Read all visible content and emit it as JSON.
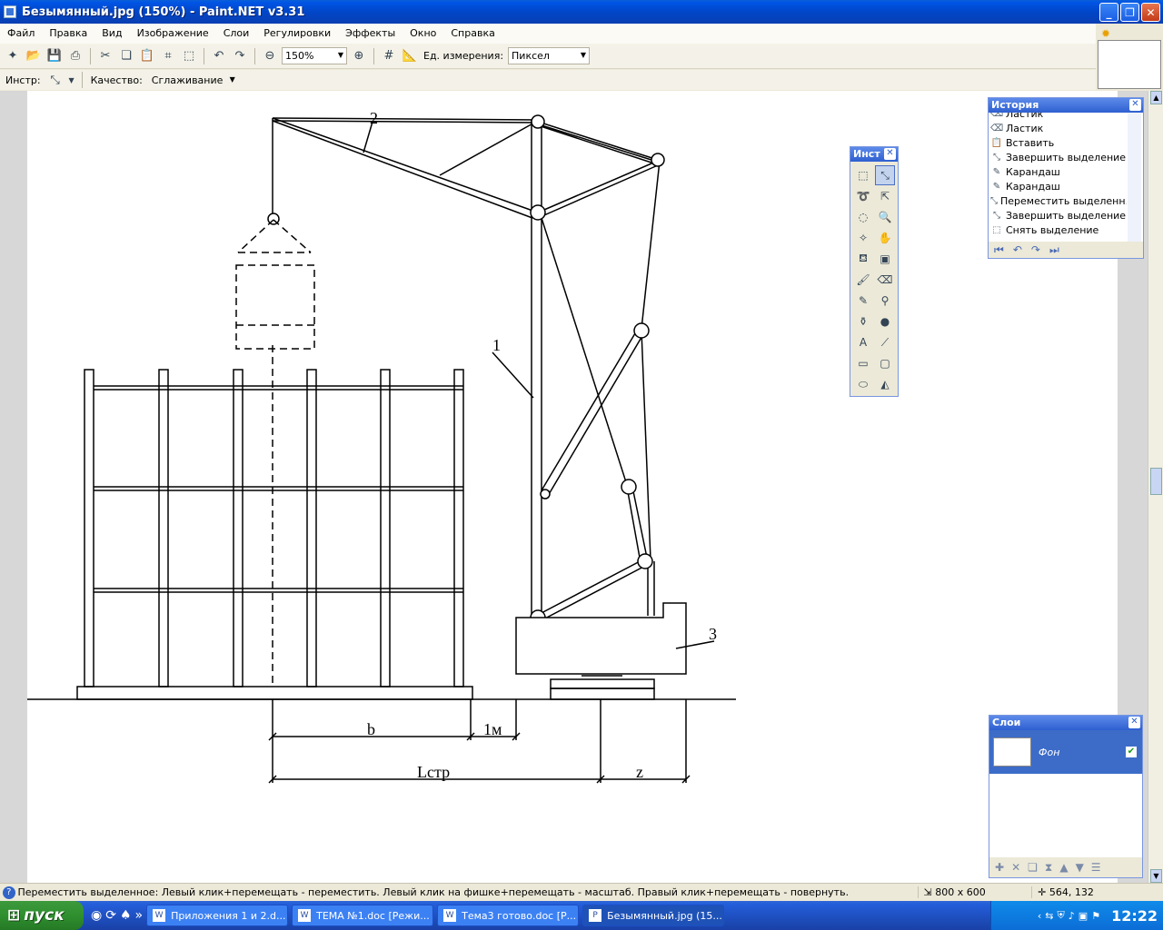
{
  "window": {
    "title": "Безымянный.jpg (150%) - Paint.NET v3.31"
  },
  "menu": [
    "Файл",
    "Правка",
    "Вид",
    "Изображение",
    "Слои",
    "Регулировки",
    "Эффекты",
    "Окно",
    "Справка"
  ],
  "toolbar": {
    "zoom_value": "150%",
    "units_label": "Ед. измерения:",
    "units_value": "Пиксел",
    "tool_label": "Инстр:",
    "quality_label": "Качество:",
    "quality_value": "Сглаживание"
  },
  "tools_panel": {
    "title": "Инст"
  },
  "history_panel": {
    "title": "История",
    "items": [
      {
        "label": "Ластик",
        "icon": "eraser-icon"
      },
      {
        "label": "Ластик",
        "icon": "eraser-icon"
      },
      {
        "label": "Вставить",
        "icon": "paste-icon"
      },
      {
        "label": "Завершить выделение",
        "icon": "move-selection-icon"
      },
      {
        "label": "Карандаш",
        "icon": "pencil-icon"
      },
      {
        "label": "Карандаш",
        "icon": "pencil-icon"
      },
      {
        "label": "Переместить выделенн...",
        "icon": "move-selection-icon"
      },
      {
        "label": "Завершить выделение",
        "icon": "move-selection-icon"
      },
      {
        "label": "Снять выделение",
        "icon": "deselect-icon"
      }
    ]
  },
  "layers_panel": {
    "title": "Слои",
    "layer_name": "Фон"
  },
  "drawing": {
    "label_1": "1",
    "label_2": "2",
    "label_3": "3",
    "dim_b": "b",
    "dim_1m": "1м",
    "dim_lstr": "Lстр",
    "dim_z": "z"
  },
  "status": {
    "help_text": "Переместить выделенное: Левый клик+перемещать - переместить. Левый клик на фишке+перемещать - масштаб. Правый клик+перемещать - повернуть.",
    "image_size": "800 x 600",
    "cursor_pos": "564, 132"
  },
  "taskbar": {
    "start_label": "пуск",
    "tasks": [
      {
        "label": "Приложения 1 и 2.d...",
        "active": false
      },
      {
        "label": "ТЕМА №1.doc [Режи...",
        "active": false
      },
      {
        "label": "Тема3 готово.doc [Р...",
        "active": false
      },
      {
        "label": "Безымянный.jpg (15...",
        "active": true
      }
    ],
    "clock": "12:22"
  }
}
